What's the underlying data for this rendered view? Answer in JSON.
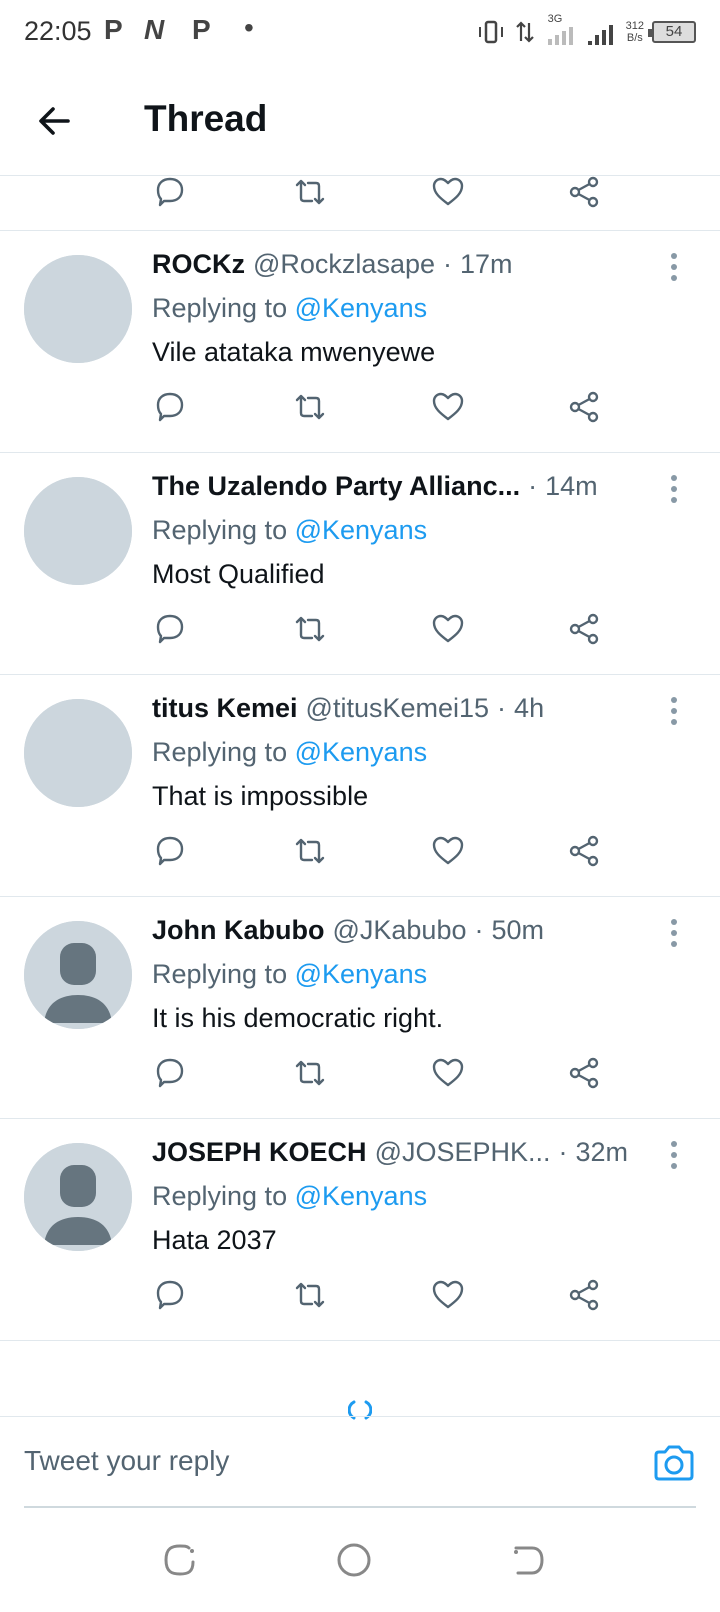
{
  "status_bar": {
    "time": "22:05",
    "app_icons": [
      "P",
      "N",
      "P"
    ],
    "net_speed_value": "312",
    "net_speed_unit": "B/s",
    "signal_label": "3G",
    "battery": "54"
  },
  "header": {
    "title": "Thread"
  },
  "tweets": [
    {
      "name": "ROCKz",
      "handle": "@Rockzlasape",
      "separator": "·",
      "time": "17m",
      "replying_prefix": "Replying to",
      "replying_to": "@Kenyans",
      "text": "Vile atataka mwenyewe",
      "avatar": "blank"
    },
    {
      "name": "The Uzalendo Party Allianc...",
      "handle": "",
      "separator": "·",
      "time": "14m",
      "replying_prefix": "Replying to",
      "replying_to": "@Kenyans",
      "text": "Most Qualified",
      "avatar": "blank"
    },
    {
      "name": "titus Kemei",
      "handle": "@titusKemei15",
      "separator": "·",
      "time": "4h",
      "replying_prefix": "Replying to",
      "replying_to": "@Kenyans",
      "text": "That is impossible",
      "avatar": "blank"
    },
    {
      "name": "John Kabubo",
      "handle": "@JKabubo",
      "separator": "·",
      "time": "50m",
      "replying_prefix": "Replying to",
      "replying_to": "@Kenyans",
      "text": "It is his democratic right.",
      "avatar": "default-person"
    },
    {
      "name": "JOSEPH KOECH",
      "handle": "@JOSEPHK...",
      "separator": "·",
      "time": "32m",
      "replying_prefix": "Replying to",
      "replying_to": "@Kenyans",
      "text": "Hata 2037",
      "avatar": "default-person"
    }
  ],
  "composer": {
    "placeholder": "Tweet your reply"
  },
  "colors": {
    "accent": "#1d9bf0",
    "secondary_text": "#536471",
    "avatar_bg": "#ccd6dd",
    "avatar_person": "#66757f",
    "icon": "#536471"
  },
  "icons": {
    "back": "arrow-left-icon",
    "reply": "speech-bubble-icon",
    "retweet": "retweet-icon",
    "like": "heart-icon",
    "share": "share-icon",
    "more": "vertical-dots-icon",
    "camera": "camera-icon",
    "loading": "spinner-icon"
  }
}
